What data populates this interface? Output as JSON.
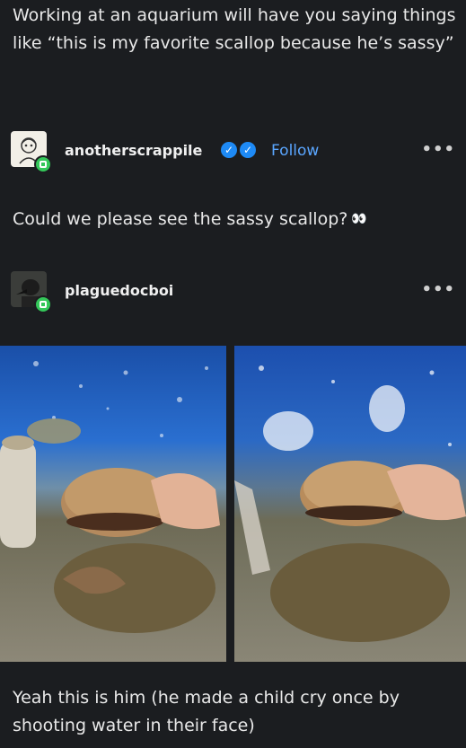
{
  "original_post": {
    "text": "Working at an aquarium will have you saying things like “this is my favorite scallop because he’s sassy”"
  },
  "reply1": {
    "username": "anotherscrappile",
    "follow_label": "Follow",
    "more_label": "•••",
    "text": "Could we please see the sassy scallop?",
    "emoji": "👀"
  },
  "reply2": {
    "username": "plaguedocboi",
    "more_label": "•••",
    "text": "Yeah this is him (he made a child cry once by shooting water in their face)"
  },
  "colors": {
    "background": "#1b1d20",
    "link": "#5aa6ff",
    "verified": "#1e8af5",
    "online": "#34c759"
  }
}
